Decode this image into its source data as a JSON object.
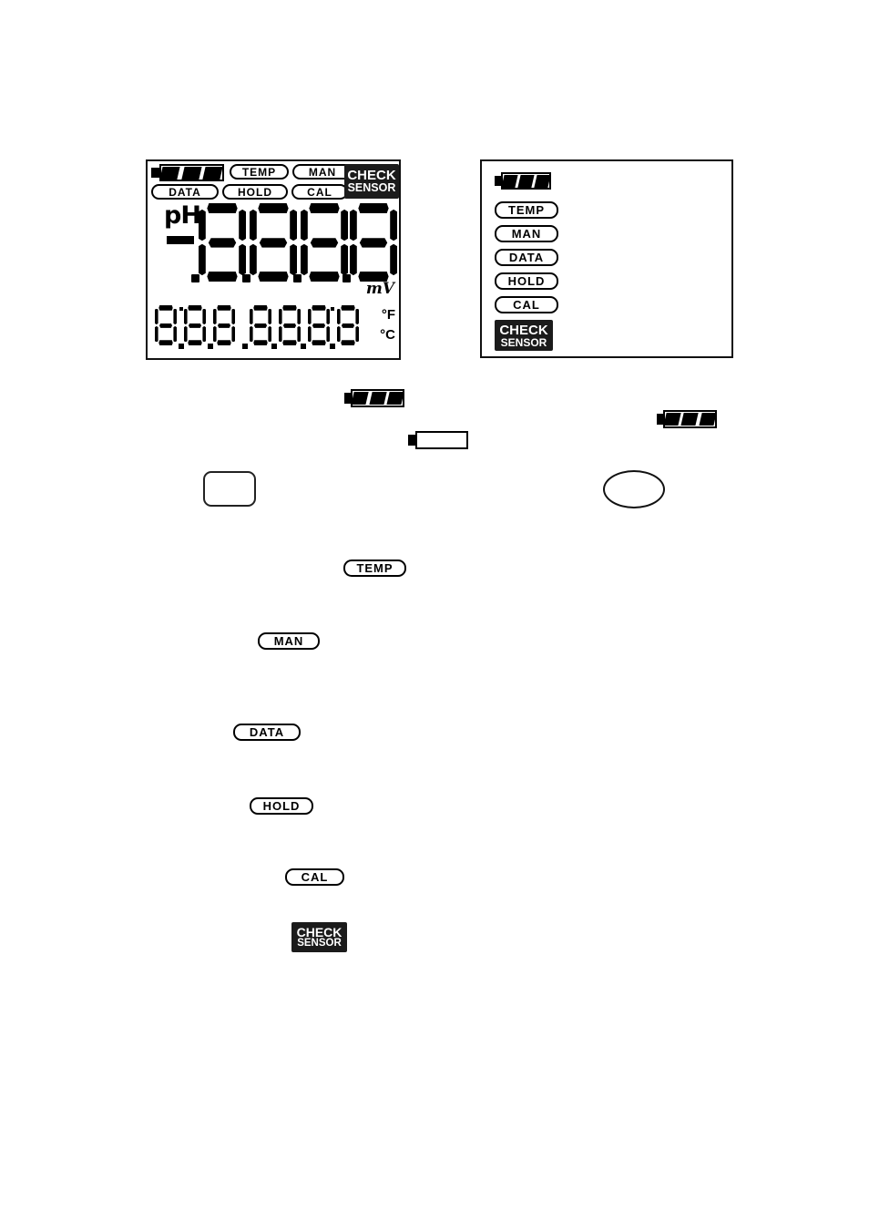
{
  "lcd_display": {
    "annunciators": {
      "battery_icon": "battery-full-icon",
      "temp": "TEMP",
      "man": "MAN",
      "data": "DATA",
      "hold": "HOLD",
      "cal": "CAL",
      "check": "CHECK",
      "sensor": "SENSOR"
    },
    "main_reading": {
      "mode_label": "pH",
      "sign": "-",
      "digits": [
        "8",
        "8",
        "8",
        "8"
      ],
      "decimal_points": 4
    },
    "secondary_reading": {
      "digits": [
        "8",
        "8",
        "8",
        "8",
        "8",
        "8",
        "8"
      ],
      "decimal_points": 6
    },
    "units": {
      "mv": "mV",
      "fahrenheit": "°F",
      "celsius": "°C"
    }
  },
  "legend_panel": {
    "battery_icon": "battery-full-icon",
    "items": [
      {
        "label": "TEMP"
      },
      {
        "label": "MAN"
      },
      {
        "label": "DATA"
      },
      {
        "label": "HOLD"
      },
      {
        "label": "CAL"
      }
    ],
    "check_sensor": {
      "line1": "CHECK",
      "line2": "SENSOR"
    }
  },
  "callouts": {
    "battery_full_icon": "battery-full-icon",
    "battery_empty_icon": "battery-empty-icon",
    "battery_full_right_icon": "battery-full-icon",
    "square_button_icon": "rounded-square-icon",
    "ellipse_button_icon": "ellipse-icon",
    "temp": "TEMP",
    "man": "MAN",
    "data": "DATA",
    "hold": "HOLD",
    "cal": "CAL",
    "check_sensor": {
      "line1": "CHECK",
      "line2": "SENSOR"
    }
  },
  "colors": {
    "ink": "#000000",
    "inverse_block": "#1b1b1b",
    "paper": "#ffffff"
  }
}
